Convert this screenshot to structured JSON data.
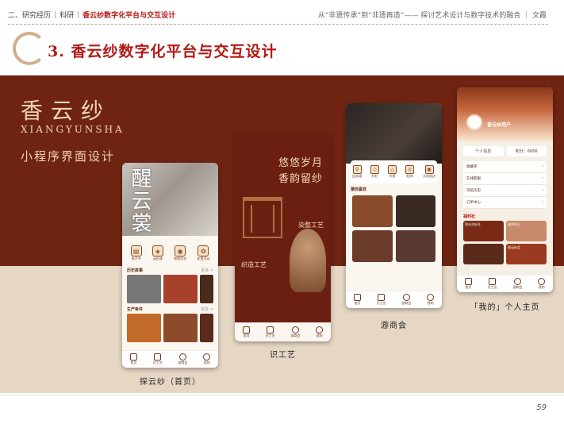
{
  "header": {
    "crumb_1": "二、研究经历",
    "crumb_2": "科研",
    "crumb_3": "香云纱数字化平台与交互设计",
    "sep": "|",
    "top_right": "从“非遗传承”到“非遗再造”—— 探讨艺术设计与数字技术的融合 ｜ 文霞"
  },
  "section": {
    "number": "3.",
    "title": "香云纱数字化平台与交互设计"
  },
  "brand": {
    "cn": "香云纱",
    "en": "XIANGYUNSHA",
    "sub": "小程序界面设计"
  },
  "phones": {
    "home": {
      "hero_text": "醒云裳",
      "icons": [
        "电子书",
        "云织课",
        "地图导览",
        "非遗活动"
      ],
      "section1": "历史故事",
      "section2": "生产条件",
      "more": "更多 >",
      "caption": "探云纱（首页）"
    },
    "craft": {
      "headline1": "悠悠岁月",
      "headline2": "香韵留纱",
      "label_dye": "染整工艺",
      "label_weave": "织造工艺",
      "caption": "识工艺"
    },
    "market": {
      "icons": [
        "连衣裙",
        "衬衫",
        "外套",
        "配饰",
        "文创周边"
      ],
      "section": "猜你喜欢",
      "caption": "游商会"
    },
    "profile": {
      "user": "香云纱用户",
      "chip_info": "个人信息",
      "chip_points": "积分：6666",
      "menu": [
        "收藏夹",
        "在线客服",
        "浏览历史",
        "订单中心"
      ],
      "perk_title": "福利社",
      "perks": [
        "积分兑好礼",
        "福利中心",
        "香云纱品"
      ],
      "caption": "「我的」个人主页"
    },
    "tabs": [
      "首页",
      "识工艺",
      "游商会",
      "我的"
    ]
  },
  "footer": {
    "page": "59"
  },
  "colors": {
    "accent": "#b21b16",
    "band": "#6f2412",
    "sand": "#e6d6c4"
  }
}
